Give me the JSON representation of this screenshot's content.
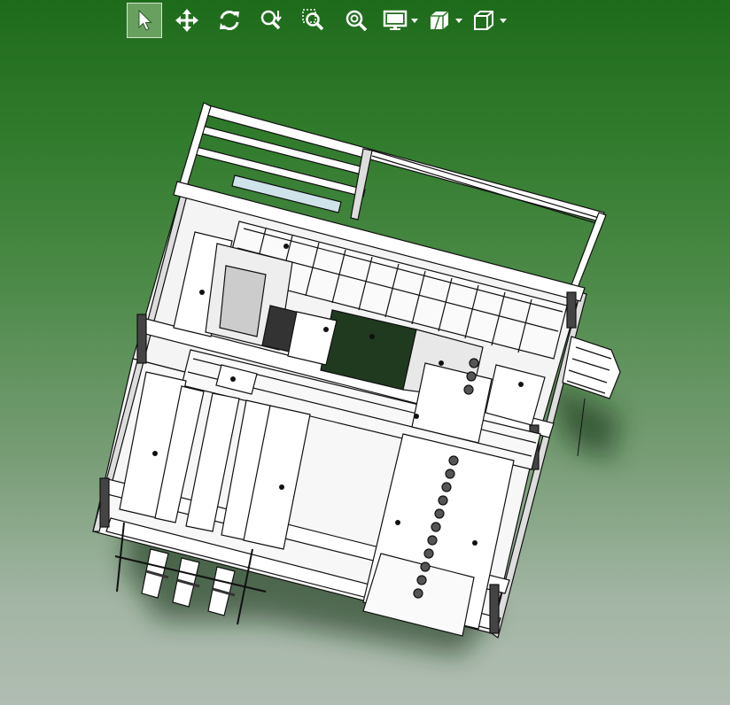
{
  "app": {
    "accent_bg_top": "#1f6b1c",
    "accent_bg_bottom": "#b1bdb3",
    "active_tool_color": "#6aa05f"
  },
  "toolbar": {
    "tools": [
      {
        "name": "select",
        "icon": "pointer-arrow-icon",
        "active": true
      },
      {
        "name": "pan",
        "icon": "move-arrows-icon",
        "active": false
      },
      {
        "name": "rotate",
        "icon": "rotate-icon",
        "active": false
      },
      {
        "name": "zoom",
        "icon": "zoom-in-out-icon",
        "active": false
      },
      {
        "name": "zoom-window",
        "icon": "zoom-window-icon",
        "active": false
      },
      {
        "name": "zoom-fit",
        "icon": "zoom-fit-icon",
        "active": false
      },
      {
        "name": "display",
        "icon": "monitor-icon",
        "active": false,
        "dropdown": true
      },
      {
        "name": "section",
        "icon": "section-view-icon",
        "active": false,
        "dropdown": true
      },
      {
        "name": "view-orientation",
        "icon": "cube-view-icon",
        "active": false,
        "dropdown": true
      }
    ]
  },
  "model": {
    "description_icon": "cad-machine-assembly-3d"
  }
}
